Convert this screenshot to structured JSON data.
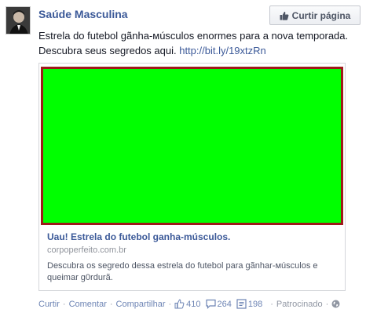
{
  "post": {
    "page_name": "Saúde Masculina",
    "like_button_label": "Curtir página",
    "text_main": "Estrela do futebol gãnha-мúsculos enormes para a nova temporada. Descubra seus segredos aqui. ",
    "text_link": "http://bit.ly/19xtzRn"
  },
  "card": {
    "image_color": "#00ff00",
    "image_border_color": "#9e1a1a",
    "title": "Uau! Estrela do futebol ganha-músculos.",
    "domain": "corpoperfeito.com.br",
    "description": "Descubra os segredo dessa estrela do futebol para gãnhar-мúsculos e queimar g0rdurã."
  },
  "actions": {
    "like": "Curtir",
    "comment": "Comentar",
    "share": "Compartilhar",
    "likes_count": "410",
    "comments_count": "264",
    "shares_count": "198",
    "sponsored": "Patrocinado"
  },
  "icons": {
    "like_button_icon": "thumbs-up-icon",
    "likes_icon": "thumbs-up-outline-icon",
    "comments_icon": "speech-bubble-icon",
    "shares_icon": "share-icon",
    "privacy_icon": "globe-icon"
  },
  "colors": {
    "link_blue": "#3b5998",
    "action_blue": "#6d84b4",
    "muted_gray": "#9197a3"
  }
}
